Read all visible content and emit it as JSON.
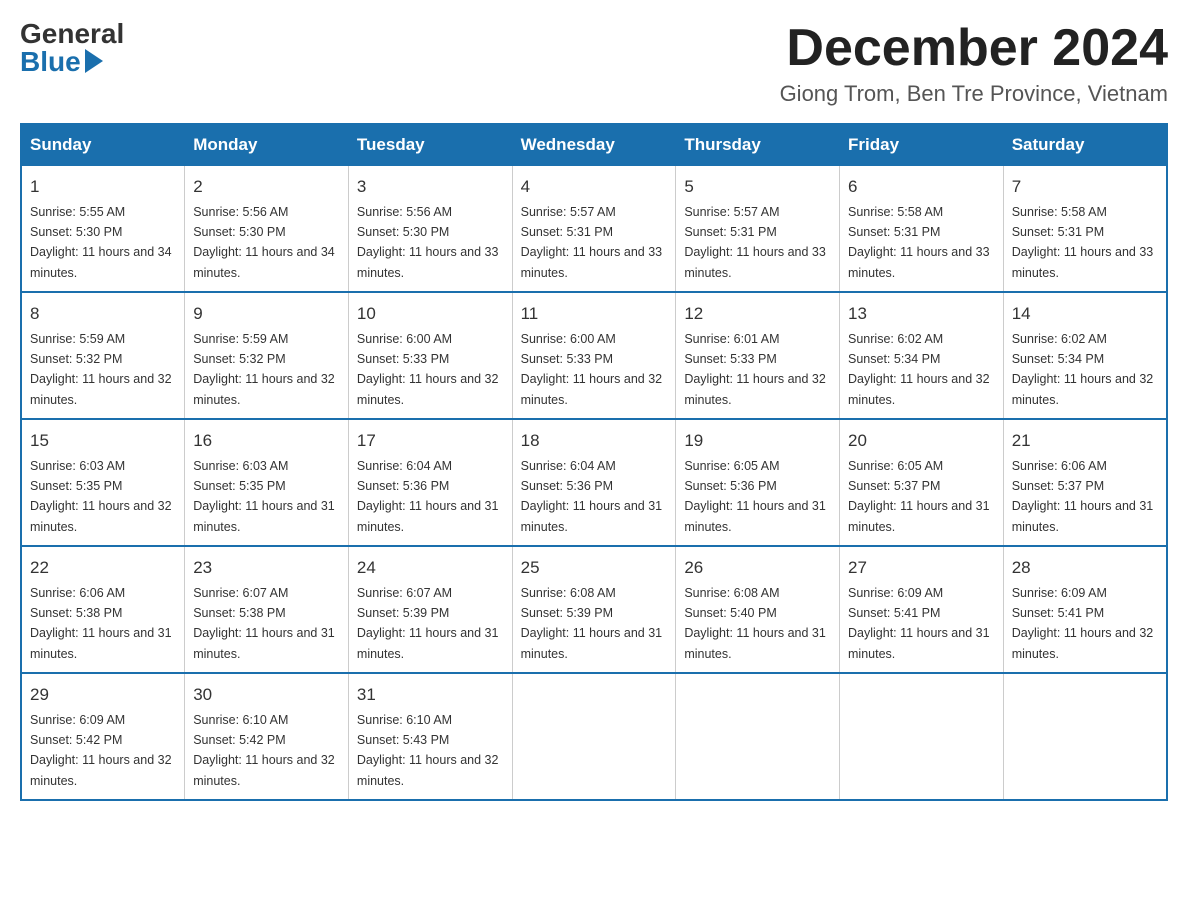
{
  "header": {
    "logo": {
      "general": "General",
      "blue": "Blue"
    },
    "title": "December 2024",
    "location": "Giong Trom, Ben Tre Province, Vietnam"
  },
  "calendar": {
    "days": [
      "Sunday",
      "Monday",
      "Tuesday",
      "Wednesday",
      "Thursday",
      "Friday",
      "Saturday"
    ],
    "weeks": [
      [
        {
          "num": "1",
          "sunrise": "5:55 AM",
          "sunset": "5:30 PM",
          "daylight": "11 hours and 34 minutes."
        },
        {
          "num": "2",
          "sunrise": "5:56 AM",
          "sunset": "5:30 PM",
          "daylight": "11 hours and 34 minutes."
        },
        {
          "num": "3",
          "sunrise": "5:56 AM",
          "sunset": "5:30 PM",
          "daylight": "11 hours and 33 minutes."
        },
        {
          "num": "4",
          "sunrise": "5:57 AM",
          "sunset": "5:31 PM",
          "daylight": "11 hours and 33 minutes."
        },
        {
          "num": "5",
          "sunrise": "5:57 AM",
          "sunset": "5:31 PM",
          "daylight": "11 hours and 33 minutes."
        },
        {
          "num": "6",
          "sunrise": "5:58 AM",
          "sunset": "5:31 PM",
          "daylight": "11 hours and 33 minutes."
        },
        {
          "num": "7",
          "sunrise": "5:58 AM",
          "sunset": "5:31 PM",
          "daylight": "11 hours and 33 minutes."
        }
      ],
      [
        {
          "num": "8",
          "sunrise": "5:59 AM",
          "sunset": "5:32 PM",
          "daylight": "11 hours and 32 minutes."
        },
        {
          "num": "9",
          "sunrise": "5:59 AM",
          "sunset": "5:32 PM",
          "daylight": "11 hours and 32 minutes."
        },
        {
          "num": "10",
          "sunrise": "6:00 AM",
          "sunset": "5:33 PM",
          "daylight": "11 hours and 32 minutes."
        },
        {
          "num": "11",
          "sunrise": "6:00 AM",
          "sunset": "5:33 PM",
          "daylight": "11 hours and 32 minutes."
        },
        {
          "num": "12",
          "sunrise": "6:01 AM",
          "sunset": "5:33 PM",
          "daylight": "11 hours and 32 minutes."
        },
        {
          "num": "13",
          "sunrise": "6:02 AM",
          "sunset": "5:34 PM",
          "daylight": "11 hours and 32 minutes."
        },
        {
          "num": "14",
          "sunrise": "6:02 AM",
          "sunset": "5:34 PM",
          "daylight": "11 hours and 32 minutes."
        }
      ],
      [
        {
          "num": "15",
          "sunrise": "6:03 AM",
          "sunset": "5:35 PM",
          "daylight": "11 hours and 32 minutes."
        },
        {
          "num": "16",
          "sunrise": "6:03 AM",
          "sunset": "5:35 PM",
          "daylight": "11 hours and 31 minutes."
        },
        {
          "num": "17",
          "sunrise": "6:04 AM",
          "sunset": "5:36 PM",
          "daylight": "11 hours and 31 minutes."
        },
        {
          "num": "18",
          "sunrise": "6:04 AM",
          "sunset": "5:36 PM",
          "daylight": "11 hours and 31 minutes."
        },
        {
          "num": "19",
          "sunrise": "6:05 AM",
          "sunset": "5:36 PM",
          "daylight": "11 hours and 31 minutes."
        },
        {
          "num": "20",
          "sunrise": "6:05 AM",
          "sunset": "5:37 PM",
          "daylight": "11 hours and 31 minutes."
        },
        {
          "num": "21",
          "sunrise": "6:06 AM",
          "sunset": "5:37 PM",
          "daylight": "11 hours and 31 minutes."
        }
      ],
      [
        {
          "num": "22",
          "sunrise": "6:06 AM",
          "sunset": "5:38 PM",
          "daylight": "11 hours and 31 minutes."
        },
        {
          "num": "23",
          "sunrise": "6:07 AM",
          "sunset": "5:38 PM",
          "daylight": "11 hours and 31 minutes."
        },
        {
          "num": "24",
          "sunrise": "6:07 AM",
          "sunset": "5:39 PM",
          "daylight": "11 hours and 31 minutes."
        },
        {
          "num": "25",
          "sunrise": "6:08 AM",
          "sunset": "5:39 PM",
          "daylight": "11 hours and 31 minutes."
        },
        {
          "num": "26",
          "sunrise": "6:08 AM",
          "sunset": "5:40 PM",
          "daylight": "11 hours and 31 minutes."
        },
        {
          "num": "27",
          "sunrise": "6:09 AM",
          "sunset": "5:41 PM",
          "daylight": "11 hours and 31 minutes."
        },
        {
          "num": "28",
          "sunrise": "6:09 AM",
          "sunset": "5:41 PM",
          "daylight": "11 hours and 32 minutes."
        }
      ],
      [
        {
          "num": "29",
          "sunrise": "6:09 AM",
          "sunset": "5:42 PM",
          "daylight": "11 hours and 32 minutes."
        },
        {
          "num": "30",
          "sunrise": "6:10 AM",
          "sunset": "5:42 PM",
          "daylight": "11 hours and 32 minutes."
        },
        {
          "num": "31",
          "sunrise": "6:10 AM",
          "sunset": "5:43 PM",
          "daylight": "11 hours and 32 minutes."
        },
        null,
        null,
        null,
        null
      ]
    ]
  }
}
